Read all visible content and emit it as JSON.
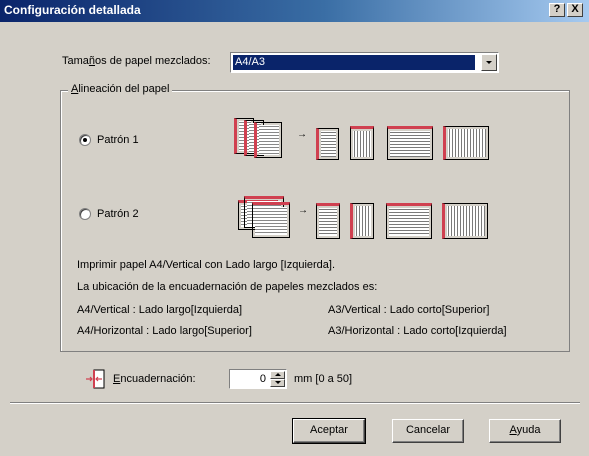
{
  "window": {
    "title": "Configuración detallada",
    "help_button": "?",
    "close_button": "X"
  },
  "paper_sizes": {
    "label_before": "Tama",
    "label_accel": "ñ",
    "label_after": "os de papel mezclados:",
    "value": "A4/A3"
  },
  "alignment": {
    "legend_accel": "A",
    "legend_rest": "lineación del papel",
    "pattern1": {
      "label": "Patrón 1",
      "selected": true
    },
    "pattern2": {
      "label": "Patrón 2",
      "selected": false
    },
    "arrow": "→",
    "description": "Imprimir papel A4/Vertical con Lado largo [Izquierda].",
    "location_heading": "La ubicación de la encuadernación de papeles mezclados es:",
    "locations": [
      "A4/Vertical : Lado largo[Izquierda]",
      "A3/Vertical : Lado corto[Superior]",
      "A4/Horizontal : Lado largo[Superior]",
      "A3/Horizontal : Lado corto[Izquierda]"
    ]
  },
  "binding": {
    "label_accel": "E",
    "label_rest": "ncuadernación:",
    "value": "0",
    "unit": "mm [0 a 50]"
  },
  "buttons": {
    "accept": "Aceptar",
    "cancel": "Cancelar",
    "help_accel": "A",
    "help_rest": "yuda"
  },
  "colors": {
    "titlebar_start": "#0a246a",
    "titlebar_end": "#a6caf0",
    "dialog_bg": "#d4d0c8",
    "binding_accent": "#d04050"
  }
}
